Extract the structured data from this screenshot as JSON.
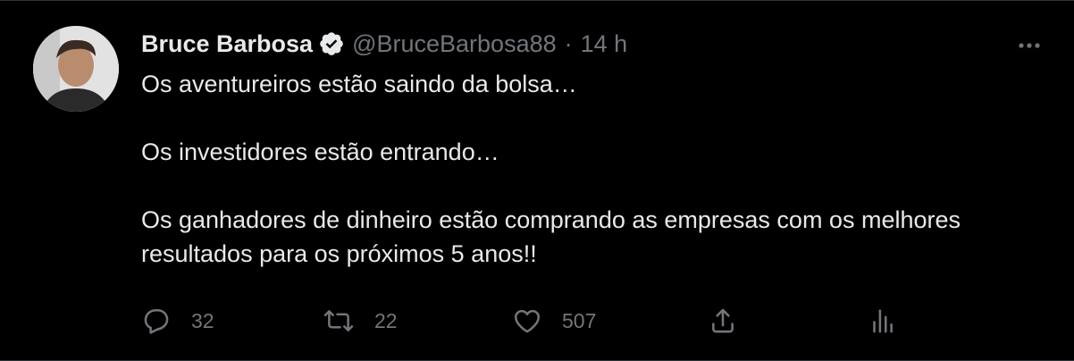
{
  "tweet": {
    "display_name": "Bruce Barbosa",
    "handle": "@BruceBarbosa88",
    "separator": "·",
    "time": "14 h",
    "paragraphs": [
      "Os aventureiros estão saindo da bolsa…",
      "Os investidores estão entrando…",
      "Os ganhadores de dinheiro estão comprando as empresas com os melhores resultados para os próximos 5 anos!!"
    ]
  },
  "actions": {
    "reply": {
      "icon": "reply-icon",
      "count": "32"
    },
    "retweet": {
      "icon": "retweet-icon",
      "count": "22"
    },
    "like": {
      "icon": "heart-icon",
      "count": "507"
    },
    "share": {
      "icon": "share-icon"
    },
    "analytics": {
      "icon": "analytics-icon"
    }
  },
  "colors": {
    "background": "#000000",
    "text": "#e7e9ea",
    "secondary": "#71767b",
    "border": "#2f3336"
  }
}
